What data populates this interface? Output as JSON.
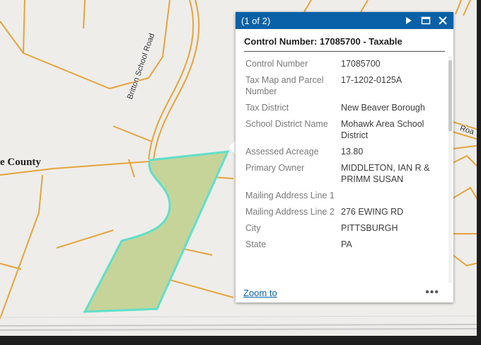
{
  "map": {
    "county_label": "e County",
    "road_label_britton": "Britton School Road",
    "road_label_right": "Roa",
    "colors": {
      "background": "#eeedea",
      "parcel_line": "#e5a43a",
      "parcel_fill": "#c6d49a",
      "selection_outline": "#5fe0c9",
      "popup_header": "#0a61a8"
    }
  },
  "popup": {
    "count": "(1 of 2)",
    "next_icon": "play-icon",
    "maximize_icon": "maximize-icon",
    "close_icon": "close-icon",
    "title": "Control Number: 17085700 - Taxable",
    "fields": [
      {
        "name": "Control Number",
        "value": "17085700"
      },
      {
        "name": "Tax Map and Parcel Number",
        "value": "17-1202-0125A"
      },
      {
        "name": "Tax District",
        "value": "New Beaver Borough"
      },
      {
        "name": "School District Name",
        "value": "Mohawk Area School District"
      },
      {
        "name": "Assessed Acreage",
        "value": "13.80"
      },
      {
        "name": "Primary Owner",
        "value": "MIDDLETON, IAN R & PRIMM SUSAN"
      },
      {
        "name": "Mailing Address Line 1",
        "value": ""
      },
      {
        "name": "Mailing Address Line 2",
        "value": "276 EWING RD"
      },
      {
        "name": "City",
        "value": "PITTSBURGH"
      },
      {
        "name": "State",
        "value": "PA"
      }
    ],
    "zoom_label": "Zoom to",
    "more_label": "•••"
  }
}
